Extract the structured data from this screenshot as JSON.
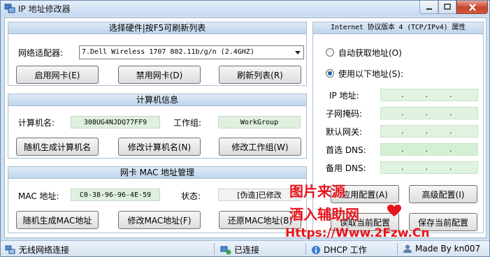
{
  "window": {
    "title": "IP 地址修改器"
  },
  "hw_panel": {
    "header": "选择硬件|按F5可刷新列表",
    "adapter_label": "网络适配器:",
    "adapter_value": "7.Dell Wireless 1707 802.11b/g/n (2.4GHZ)",
    "enable_btn": "启用网卡(E)",
    "disable_btn": "禁用网卡(D)",
    "refresh_btn": "刷新列表(R)"
  },
  "pc_panel": {
    "header": "计算机信息",
    "name_label": "计算机名:",
    "name_value": "308UG4NJDQ77FF9",
    "group_label": "工作组:",
    "group_value": "WorkGroup",
    "random_btn": "随机生成计算机名",
    "rename_btn": "修改计算机名(N)",
    "regroup_btn": "修改工作组(W)"
  },
  "mac_panel": {
    "header": "网卡 MAC 地址管理",
    "mac_label": "MAC 地址:",
    "mac_value": "C0-38-96-96-4E-59",
    "status_label": "状态:",
    "status_value": "[伪造]已修改",
    "random_btn": "随机生成MAC地址",
    "modify_btn": "修改MAC地址(F)",
    "restore_btn": "还原MAC地址(B)"
  },
  "ip_panel": {
    "header": "Internet 协议版本 4 (TCP/IPv4) 属性",
    "auto_radio": "自动获取地址(O)",
    "manual_radio": "使用以下地址(S):",
    "selected": "manual",
    "fields": [
      {
        "label": "IP 地址:"
      },
      {
        "label": "子网掩码:"
      },
      {
        "label": "默认网关:"
      },
      {
        "label": "首选 DNS:"
      },
      {
        "label": "备用 DNS:"
      }
    ],
    "apply_btn": "应用配置(A)",
    "advanced_btn": "高级配置(I)",
    "read_btn": "读取当前配置",
    "save_btn": "保存当前配置"
  },
  "statusbar": {
    "network": "无线网络连接",
    "connection": "已连接",
    "dhcp": "DHCP 工作",
    "author": "Made By kn007"
  },
  "watermark": {
    "line1": "图片来源",
    "line2": "酒入辅助网",
    "line3": "Https://Www.2Fzw.Cn"
  },
  "colors": {
    "accent": "#1d5fa8",
    "watermark": "#e8141c",
    "value_bg": "#dff0df"
  }
}
